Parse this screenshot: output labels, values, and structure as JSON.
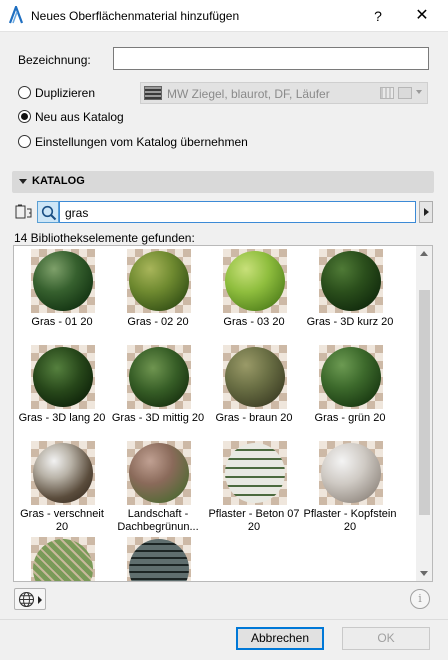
{
  "window": {
    "title": "Neues Oberflächenmaterial hinzufügen",
    "help_label": "?",
    "close_label": "✕"
  },
  "form": {
    "name_label": "Bezeichnung:",
    "name_value": ""
  },
  "options": {
    "duplicate": {
      "label": "Duplizieren",
      "selected": false
    },
    "new_from_catalog": {
      "label": "Neu aus Katalog",
      "selected": true
    },
    "settings_from_catalog": {
      "label": "Einstellungen vom Katalog übernehmen",
      "selected": false
    },
    "duplicate_source": "MW Ziegel, blaurot, DF, Läufer"
  },
  "catalog": {
    "section_label": "KATALOG",
    "search_value": "gras",
    "results_text": "14 Bibliothekselemente gefunden:",
    "items": [
      {
        "label": "Gras - 01 20",
        "swatch": "grass-dark"
      },
      {
        "label": "Gras - 02 20",
        "swatch": "grass-moss"
      },
      {
        "label": "Gras - 03 20",
        "swatch": "grass-light"
      },
      {
        "label": "Gras - 3D kurz 20",
        "swatch": "grass-deep"
      },
      {
        "label": "Gras - 3D lang 20",
        "swatch": "grass-spiky-dark"
      },
      {
        "label": "Gras - 3D mittig 20",
        "swatch": "grass-spiky"
      },
      {
        "label": "Gras - braun 20",
        "swatch": "grass-brown"
      },
      {
        "label": "Gras - grün 20",
        "swatch": "grass-green"
      },
      {
        "label": "Gras - verschneit 20",
        "swatch": "grass-snow"
      },
      {
        "label": "Landschaft - Dachbegrünun...",
        "swatch": "roof-green"
      },
      {
        "label": "Pflaster - Beton 07 20",
        "swatch": "paving-concrete"
      },
      {
        "label": "Pflaster - Kopfstein 20",
        "swatch": "paving-cobble"
      },
      {
        "label": "",
        "swatch": "grass-grid"
      },
      {
        "label": "",
        "swatch": "stone-mosaic"
      }
    ]
  },
  "buttons": {
    "cancel": "Abbrechen",
    "ok": "OK",
    "info": "i"
  },
  "icons": {
    "app": "archicad-icon",
    "folder": "folder-tree-icon",
    "search": "search-icon",
    "globe": "globe-icon"
  }
}
